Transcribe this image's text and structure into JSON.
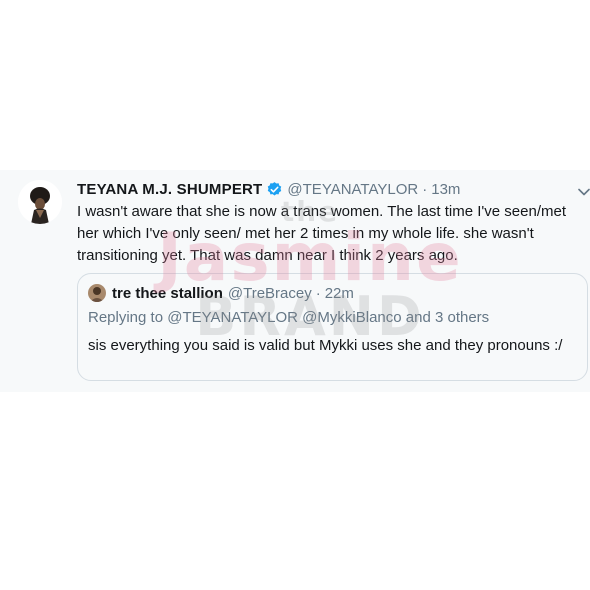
{
  "tweet": {
    "display_name": "TEYANA M.J. SHUMPERT",
    "handle": "@TEYANATAYLOR",
    "separator": "·",
    "time": "13m",
    "verified_icon": "verified-badge-icon",
    "more_icon": "chevron-down-icon",
    "text": "I wasn't aware that she is now a trans women. The last time I've seen/met her which I've only seen/ met her 2 times in my whole life. she wasn't transitioning yet. That was damn near I think 2 years ago."
  },
  "quote": {
    "display_name": "tre thee stallion",
    "handle": "@TreBracey",
    "separator": "·",
    "time": "22m",
    "replying_to": "Replying to @TEYANATAYLOR @MykkiBlanco and 3 others",
    "text": "sis everything you said is valid but Mykki uses she and they pronouns :/"
  },
  "watermark": {
    "line1": "the",
    "line2": "Jasmine",
    "line3": "BRAND"
  },
  "colors": {
    "verified": "#1da1f2",
    "secondary_text": "#657786",
    "primary_text": "#14171a",
    "card_background": "#f7f9fa"
  }
}
